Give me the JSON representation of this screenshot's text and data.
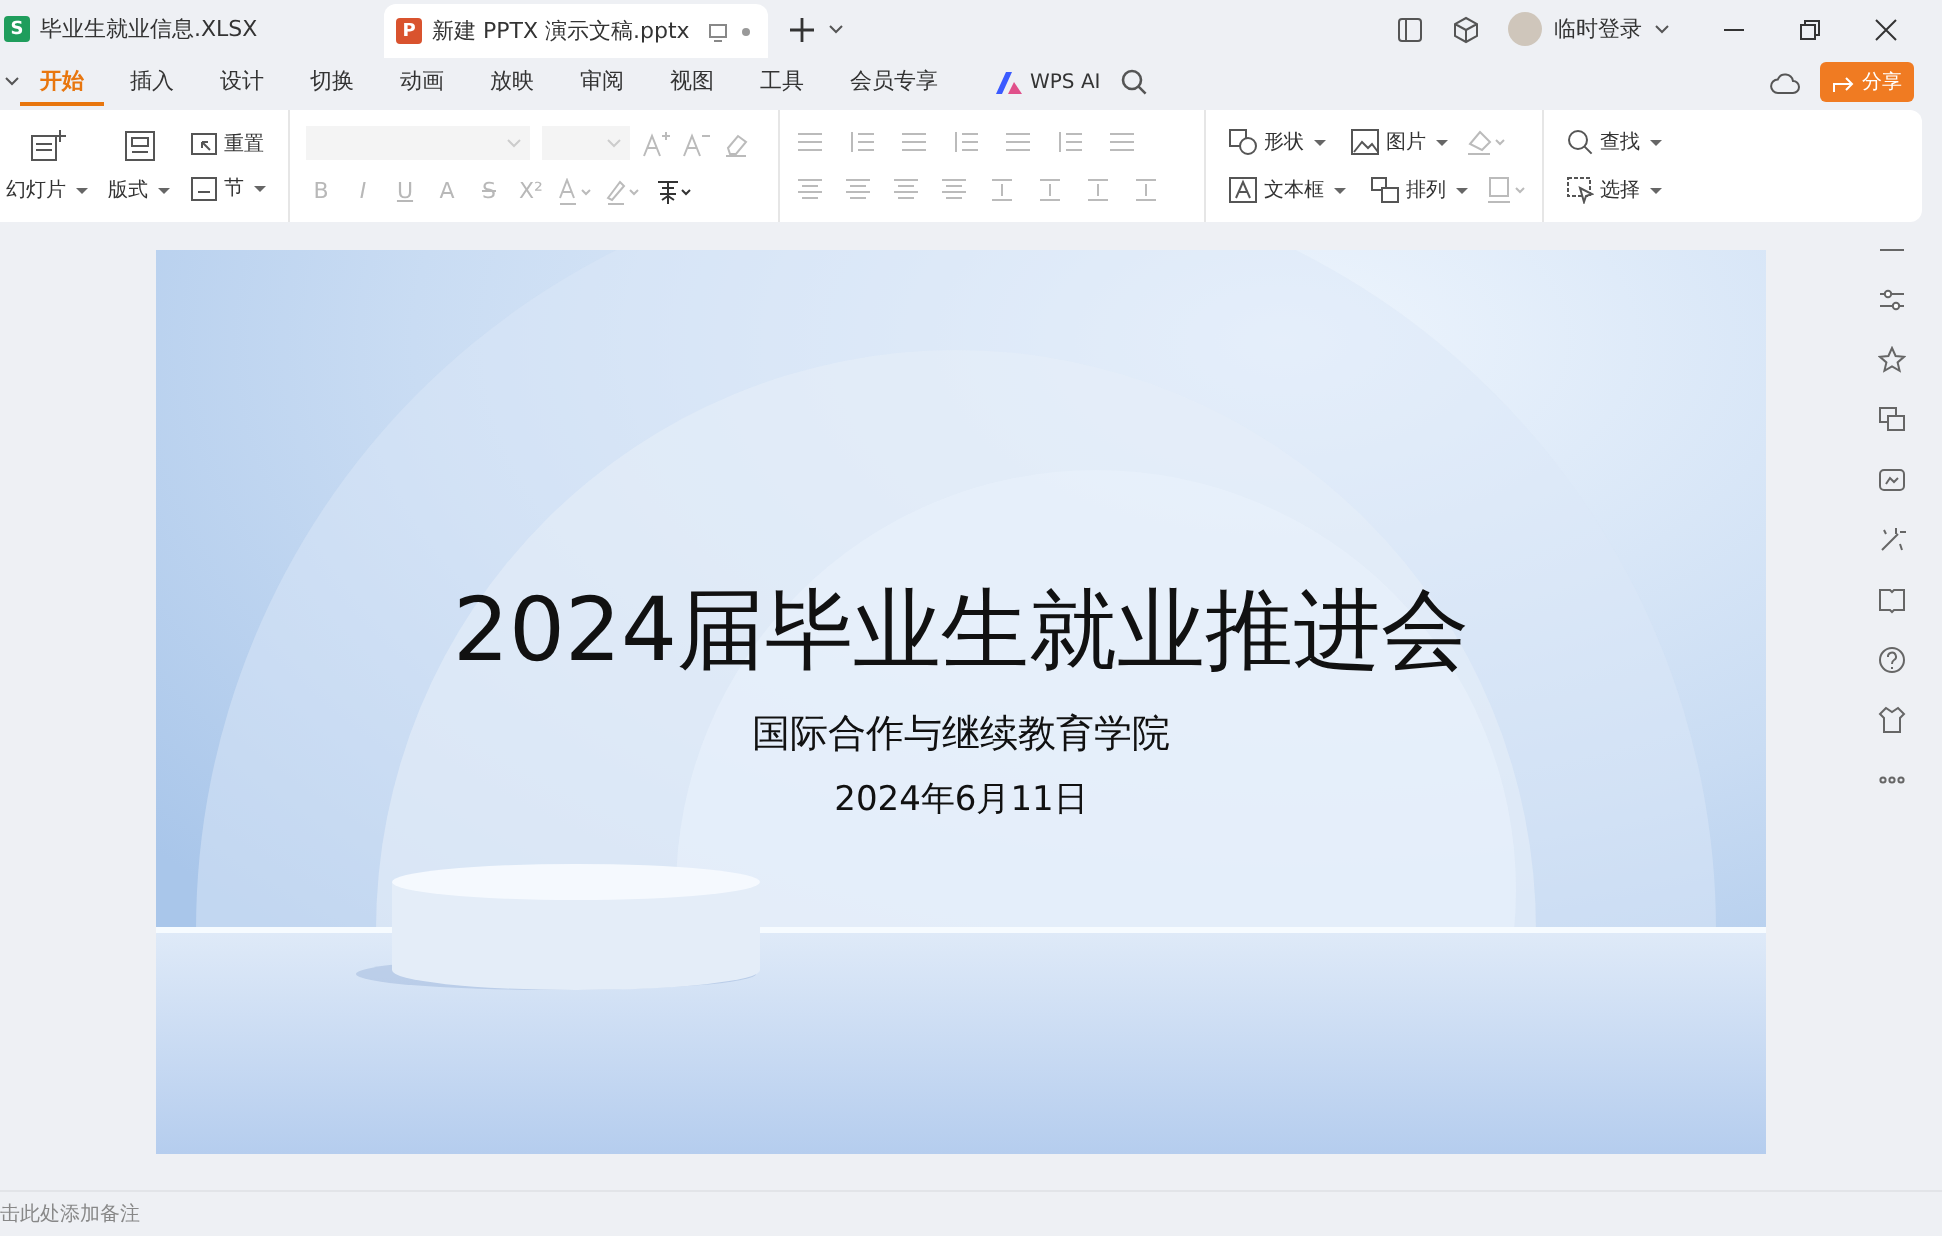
{
  "doc_tabs": [
    {
      "label": "毕业生就业信息.XLSX",
      "kind": "sheet",
      "badge": "S",
      "selected": false
    },
    {
      "label": "新建 PPTX 演示文稿.pptx",
      "kind": "slides",
      "badge": "P",
      "selected": true
    }
  ],
  "account": {
    "name": "临时登录"
  },
  "menu": [
    {
      "label": "开始",
      "selected": true
    },
    {
      "label": "插入",
      "selected": false
    },
    {
      "label": "设计",
      "selected": false
    },
    {
      "label": "切换",
      "selected": false
    },
    {
      "label": "动画",
      "selected": false
    },
    {
      "label": "放映",
      "selected": false
    },
    {
      "label": "审阅",
      "selected": false
    },
    {
      "label": "视图",
      "selected": false
    },
    {
      "label": "工具",
      "selected": false
    },
    {
      "label": "会员专享",
      "selected": false
    }
  ],
  "ai_button": "WPS AI",
  "share_button": "分享",
  "ribbon": {
    "slides": [
      {
        "label": "幻灯片",
        "dropdown": true
      },
      {
        "label": "版式",
        "dropdown": true
      },
      {
        "label": "重置",
        "dropdown": false
      },
      {
        "label": "节",
        "dropdown": true
      }
    ],
    "font_format": [
      {
        "label": "B",
        "disabled": true
      },
      {
        "label": "I",
        "disabled": true
      },
      {
        "label": "U",
        "disabled": true
      },
      {
        "label": "A",
        "disabled": true
      },
      {
        "label": "S",
        "disabled": true
      },
      {
        "label": "X²",
        "disabled": true
      }
    ],
    "insert": [
      {
        "label": "形状",
        "dropdown": true
      },
      {
        "label": "图片",
        "dropdown": true
      },
      {
        "label": "文本框",
        "dropdown": true
      },
      {
        "label": "排列",
        "dropdown": true
      }
    ],
    "edit": [
      {
        "label": "查找",
        "dropdown": true
      },
      {
        "label": "选择",
        "dropdown": true
      }
    ]
  },
  "slide": {
    "title": "2024届毕业生就业推进会",
    "subtitle": "国际合作与继续教育学院",
    "date": "2024年6月11日"
  },
  "notes": {
    "placeholder": "击此处添加备注"
  }
}
